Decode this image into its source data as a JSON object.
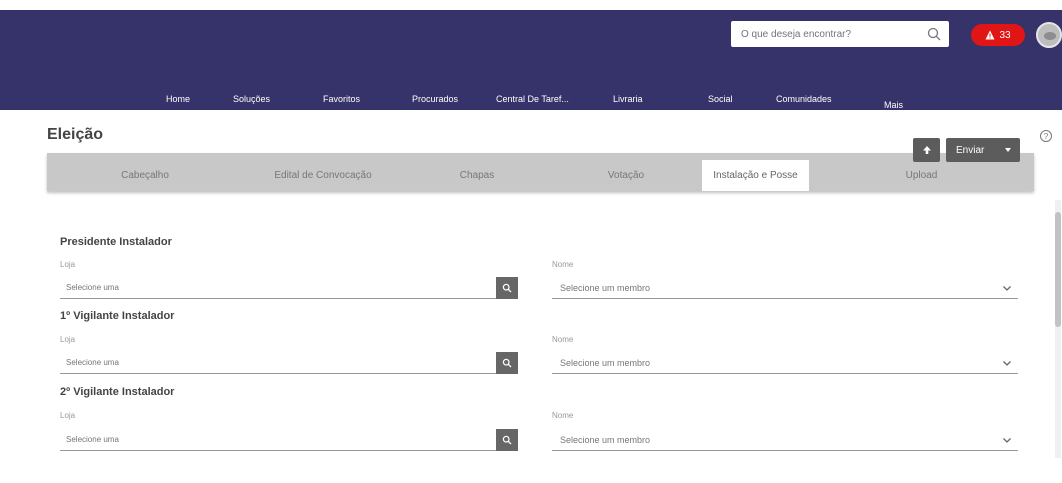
{
  "header": {
    "search_placeholder": "O que deseja encontrar?",
    "alert_count": "33",
    "nav": [
      "Home",
      "Soluções",
      "Favoritos",
      "Procurados",
      "Central De Taref...",
      "Livraria",
      "Social",
      "Comunidades",
      "Mais"
    ]
  },
  "page": {
    "title": "Eleição"
  },
  "tabs": [
    "Cabeçalho",
    "Edital de Convocação",
    "Chapas",
    "Votação",
    "Instalação e Posse",
    "Upload"
  ],
  "toolbar": {
    "send_label": "Enviar"
  },
  "sections": [
    {
      "title": "Presidente Instalador",
      "loja_label": "Loja",
      "loja_placeholder": "Selecione uma",
      "nome_label": "Nome",
      "nome_value": "Selecione um membro"
    },
    {
      "title": "1º Vigilante Instalador",
      "loja_label": "Loja",
      "loja_placeholder": "Selecione uma",
      "nome_label": "Nome",
      "nome_value": "Selecione um membro"
    },
    {
      "title": "2º Vigilante Instalador",
      "loja_label": "Loja",
      "loja_placeholder": "Selecione uma",
      "nome_label": "Nome",
      "nome_value": "Selecione um membro"
    }
  ],
  "colors": {
    "header_bg": "#36326a",
    "alert_badge": "#e01515",
    "button_bg": "#5c5c5c",
    "tabs_bg": "#c8c8c8"
  },
  "icons": [
    "search-icon",
    "alert-icon",
    "avatar",
    "arrow-up-icon",
    "caret-down-icon",
    "help-icon",
    "search-lookup-icon",
    "chevron-down-icon"
  ]
}
